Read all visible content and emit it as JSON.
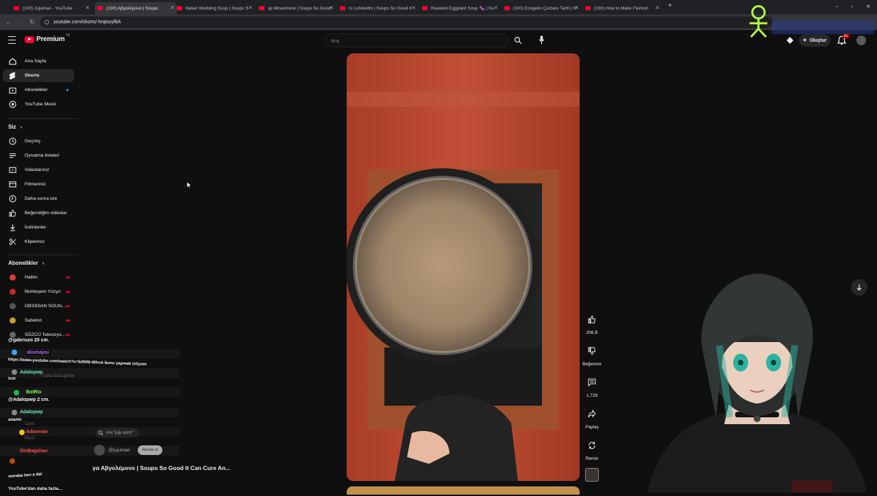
{
  "browser": {
    "tabs": [
      {
        "label": "(100) Jujumao - YouTube",
        "active": false
      },
      {
        "label": "(100) Αβγολέμονο | Soups",
        "active": true
      },
      {
        "label": "Italian Wedding Soup | Soups S",
        "active": false
      },
      {
        "label": "зр Minestrone | Soups So Good",
        "active": false
      },
      {
        "label": "rs Lohikeitto | Soups So Good It",
        "active": false
      },
      {
        "label": "Roasted Eggplant Soup 🍆 | So",
        "active": false
      },
      {
        "label": "(100) Ezogelin Çorbası Tarifi | H",
        "active": false
      },
      {
        "label": "(100) How to Make Flemish",
        "active": false
      }
    ],
    "url": "youtube.com/shorts/-hrqtsxyf8A"
  },
  "header": {
    "logo_text": "Premium",
    "logo_region": "TR",
    "search_placeholder": "Ara",
    "create_label": "Oluştur",
    "notif_count": "9+"
  },
  "sidebar": {
    "main": [
      {
        "label": "Ana Sayfa",
        "icon": "home-icon"
      },
      {
        "label": "Shorts",
        "icon": "shorts-icon",
        "active": true
      },
      {
        "label": "Abonelikler",
        "icon": "subscriptions-icon"
      },
      {
        "label": "YouTube Music",
        "icon": "music-icon"
      }
    ],
    "you_title": "Siz",
    "you": [
      {
        "label": "Geçmiş",
        "icon": "history-icon"
      },
      {
        "label": "Oynatma listeleri",
        "icon": "playlists-icon"
      },
      {
        "label": "Videolarınız",
        "icon": "your-videos-icon"
      },
      {
        "label": "Filmleriniz",
        "icon": "movies-icon"
      },
      {
        "label": "Daha sonra izle",
        "icon": "watch-later-icon"
      },
      {
        "label": "Beğendiğim videolar",
        "icon": "liked-icon"
      },
      {
        "label": "İndirilenler",
        "icon": "download-icon"
      },
      {
        "label": "Klipleriniz",
        "icon": "clips-icon"
      }
    ],
    "subs_title": "Abonelikler",
    "subs": [
      {
        "label": "Halktv",
        "color": "#e53935"
      },
      {
        "label": "Muhteşem Yüzyıl",
        "color": "#c62828"
      },
      {
        "label": "OBSIDIAN SOUN...",
        "color": "#555555"
      },
      {
        "label": "Sabaton",
        "color": "#c9a227"
      },
      {
        "label": "SÖZCÜ Televizyo...",
        "color": "#666666"
      }
    ]
  },
  "chat": {
    "messages": [
      {
        "text": "@gabriuzo 20 cm."
      },
      {
        "user": "akumajou"
      },
      {
        "text": "https://www.youtube.com/watch?v=5d5R9-WhnA bunu yapmak istiyom"
      },
      {
        "user": "Adalopwp"
      },
      {
        "text": "tcm"
      },
      {
        "user": "BotRix"
      },
      {
        "text": "@Adalopwp 2 cm."
      },
      {
        "user": "Adalopwp"
      },
      {
        "text": "ananin"
      },
      {
        "user": "Adaxman"
      },
      {
        "user": "DinBagzhan"
      },
      {
        "text": "meraba ben a dal"
      },
      {
        "text": "YouTube'dan daha fazla..."
      }
    ],
    "dim_labels": [
      "Canlı",
      "Oyun",
      "Daha fazla göster"
    ]
  },
  "mini_player": {
    "search_label": "Ara \"juju asmr\"",
    "channel": "@jujumao",
    "subscribe_label": "Abone ol",
    "title": "γα Αβγολέμονο | Soups So Good It Can Cure An..."
  },
  "actions": {
    "like_count": "208 B",
    "dislike_label": "Beğenme",
    "comment_count": "1.729",
    "share_label": "Paylaş",
    "remix_label": "Remix"
  },
  "colors": {
    "background": "#0f0f0f",
    "accent": "#ff0033",
    "video_tone": "#b0442c"
  }
}
